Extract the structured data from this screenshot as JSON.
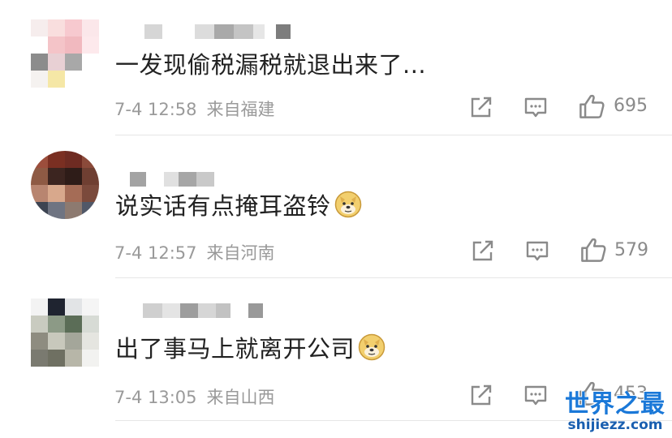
{
  "comments": [
    {
      "text": "一发现偷税漏税就退出来了...",
      "date": "7-4 12:58",
      "location": "来自福建",
      "likes": "695",
      "has_emoji": false
    },
    {
      "text": "说实话有点掩耳盗铃",
      "date": "7-4 12:57",
      "location": "来自河南",
      "likes": "579",
      "has_emoji": true,
      "emoji": "doge-emoji"
    },
    {
      "text": "出了事马上就离开公司",
      "date": "7-4 13:05",
      "location": "来自山西",
      "likes": "453",
      "has_emoji": true,
      "emoji": "doge-emoji"
    }
  ],
  "icons": {
    "share": "share-icon",
    "comment": "comment-icon",
    "like": "thumbs-up-icon"
  },
  "watermark": {
    "title": "世界之最",
    "url": "shijiezz.com"
  },
  "colors": {
    "text": "#222222",
    "meta": "#9a9a9a",
    "icon": "#8a8a8a",
    "watermark": "#1a78d8"
  }
}
